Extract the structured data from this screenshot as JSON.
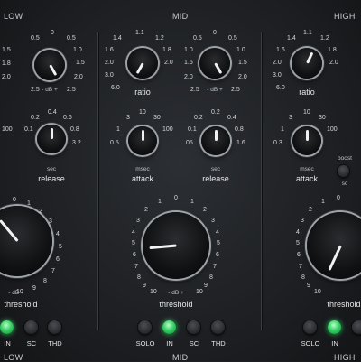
{
  "bands": {
    "low": "LOW",
    "mid": "MID",
    "high": "HIGH"
  },
  "labels": {
    "ratio": "ratio",
    "release": "release",
    "attack": "attack",
    "threshold": "threshold",
    "sec": "sec",
    "msec": "msec",
    "db": "- dB +",
    "boost": "boost",
    "sc": "sc"
  },
  "scales": {
    "gain": [
      "0.5",
      "0",
      "0.5",
      "1.0",
      "1.5",
      "2.0",
      "2.5",
      "1.5",
      "1.8",
      "2.0",
      "2.5"
    ],
    "ratio": [
      "1.4",
      "1.1",
      "1.2",
      "1.6",
      "2.0",
      "3.0",
      "4.0",
      "6.0",
      "1.8",
      "2.0"
    ],
    "release": [
      "0.2",
      "0.4",
      "0.6",
      "0.1",
      "0.8",
      ".05",
      "1.6",
      "3.2"
    ],
    "attack": [
      "3",
      "10",
      "30",
      "1",
      "100",
      "0.5",
      "0.3"
    ],
    "threshold": [
      "0",
      "1",
      "2",
      "3",
      "4",
      "5",
      "6",
      "7",
      "8",
      "9",
      "10"
    ]
  },
  "buttons": {
    "solo": "SOLO",
    "in": "IN",
    "sc": "SC",
    "thd": "THD"
  },
  "colors": {
    "led_on": "#37d067",
    "panel": "#1e2023"
  }
}
